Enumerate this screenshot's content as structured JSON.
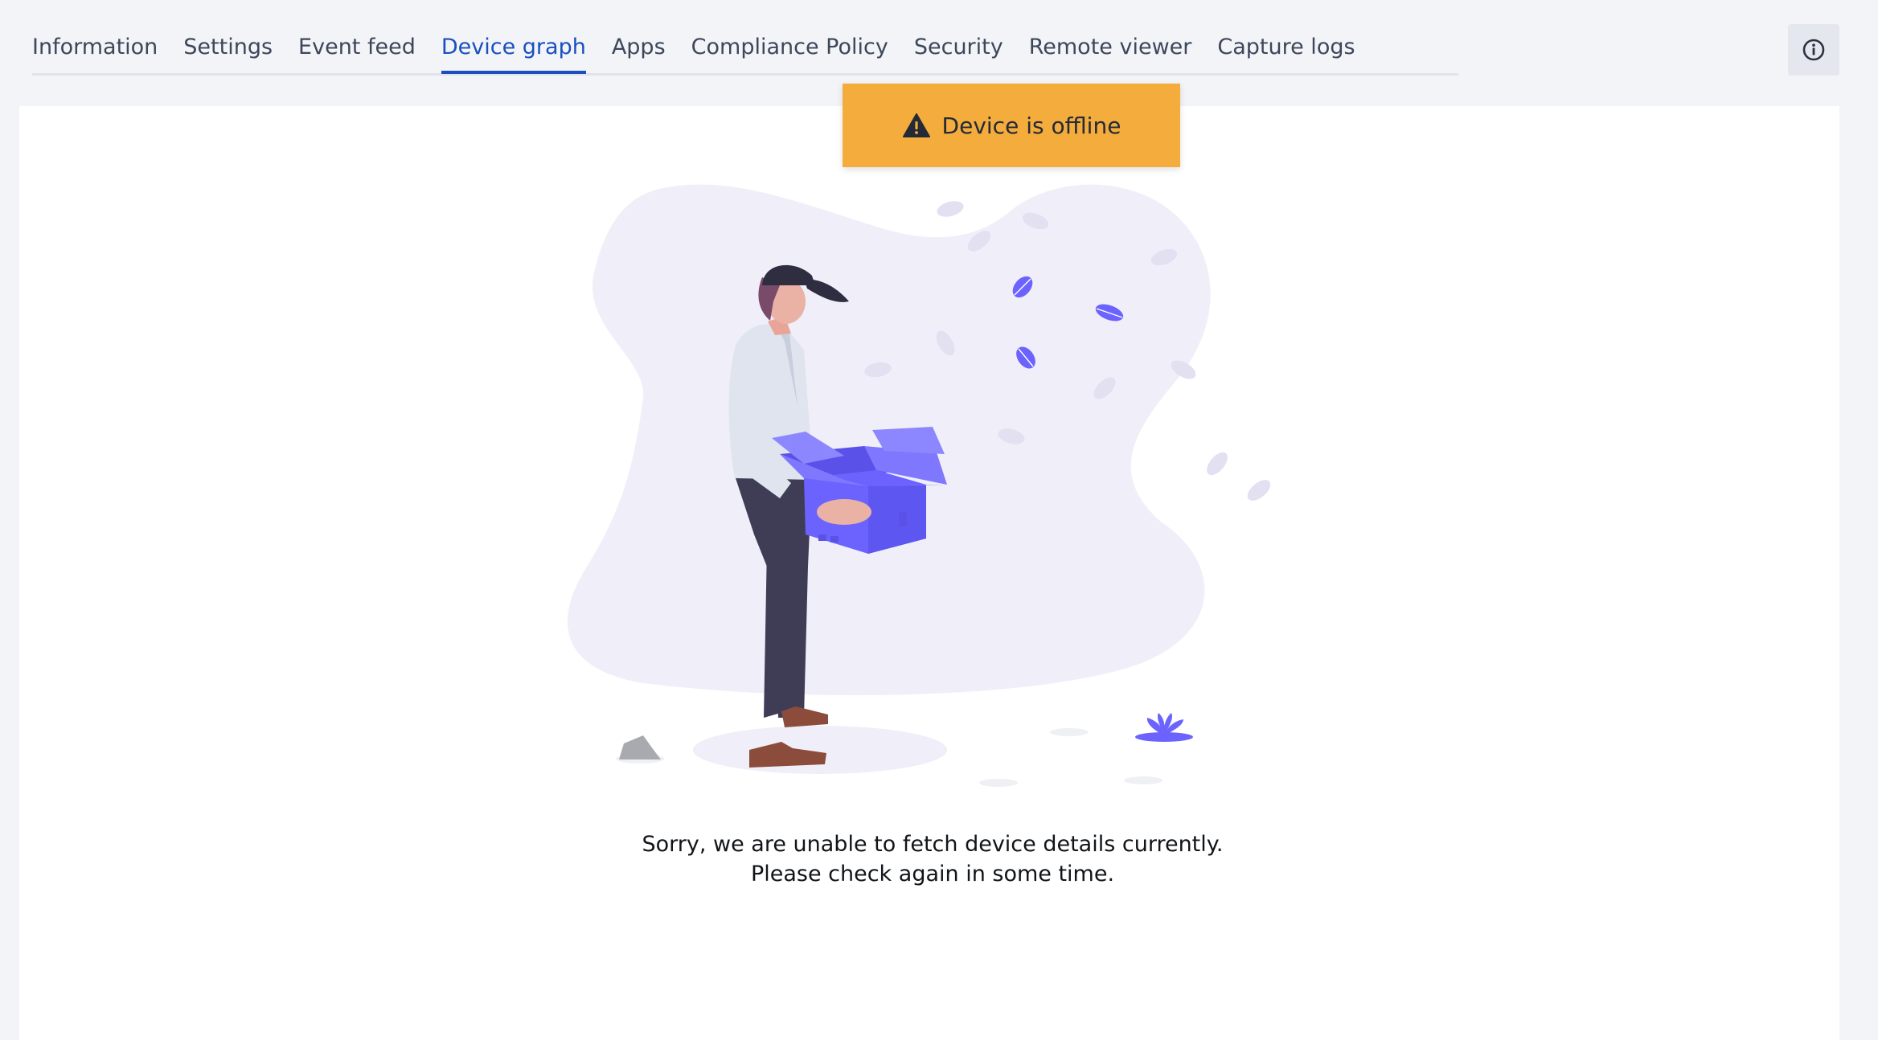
{
  "tabs": [
    {
      "label": "Information",
      "active": false
    },
    {
      "label": "Settings",
      "active": false
    },
    {
      "label": "Event feed",
      "active": false
    },
    {
      "label": "Device graph",
      "active": true
    },
    {
      "label": "Apps",
      "active": false
    },
    {
      "label": "Compliance Policy",
      "active": false
    },
    {
      "label": "Security",
      "active": false
    },
    {
      "label": "Remote viewer",
      "active": false
    },
    {
      "label": "Capture logs",
      "active": false
    }
  ],
  "header": {
    "info_icon": "info-circle-icon"
  },
  "banner": {
    "icon": "warning-icon",
    "text": "Device is offline",
    "color": "#f4ac3c"
  },
  "empty_state": {
    "illustration": "person-holding-box-illustration",
    "message_line1": "Sorry, we are unable to fetch device details currently.",
    "message_line2": "Please check again in some time."
  },
  "colors": {
    "accent": "#1a4fc0",
    "illustration_primary": "#6c63ff",
    "background": "#f2f4f8"
  }
}
